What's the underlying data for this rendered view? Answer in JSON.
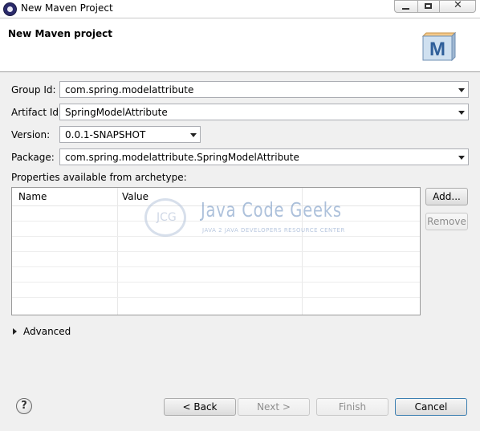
{
  "window": {
    "title": "New Maven Project"
  },
  "header": {
    "title": "New Maven project",
    "logo_letter": "M"
  },
  "form": {
    "group_id_label": "Group Id:",
    "group_id_value": "com.spring.modelattribute",
    "artifact_id_label": "Artifact Id:",
    "artifact_id_value": "SpringModelAttribute",
    "version_label": "Version:",
    "version_value": "0.0.1-SNAPSHOT",
    "package_label": "Package:",
    "package_value": "com.spring.modelattribute.SpringModelAttribute"
  },
  "properties": {
    "label": "Properties available from archetype:",
    "columns": [
      "Name",
      "Value"
    ],
    "add_button": "Add...",
    "remove_button": "Remove"
  },
  "watermark": {
    "logo_text": "JCG",
    "title": "Java Code Geeks",
    "subtitle": "JAVA 2 JAVA DEVELOPERS RESOURCE CENTER"
  },
  "advanced": {
    "label": "Advanced"
  },
  "footer": {
    "help": "?",
    "back": "< Back",
    "next": "Next >",
    "finish": "Finish",
    "cancel": "Cancel"
  },
  "colors": {
    "body_bg": "#f0f0f0",
    "watermark": "#6b8fbf"
  }
}
